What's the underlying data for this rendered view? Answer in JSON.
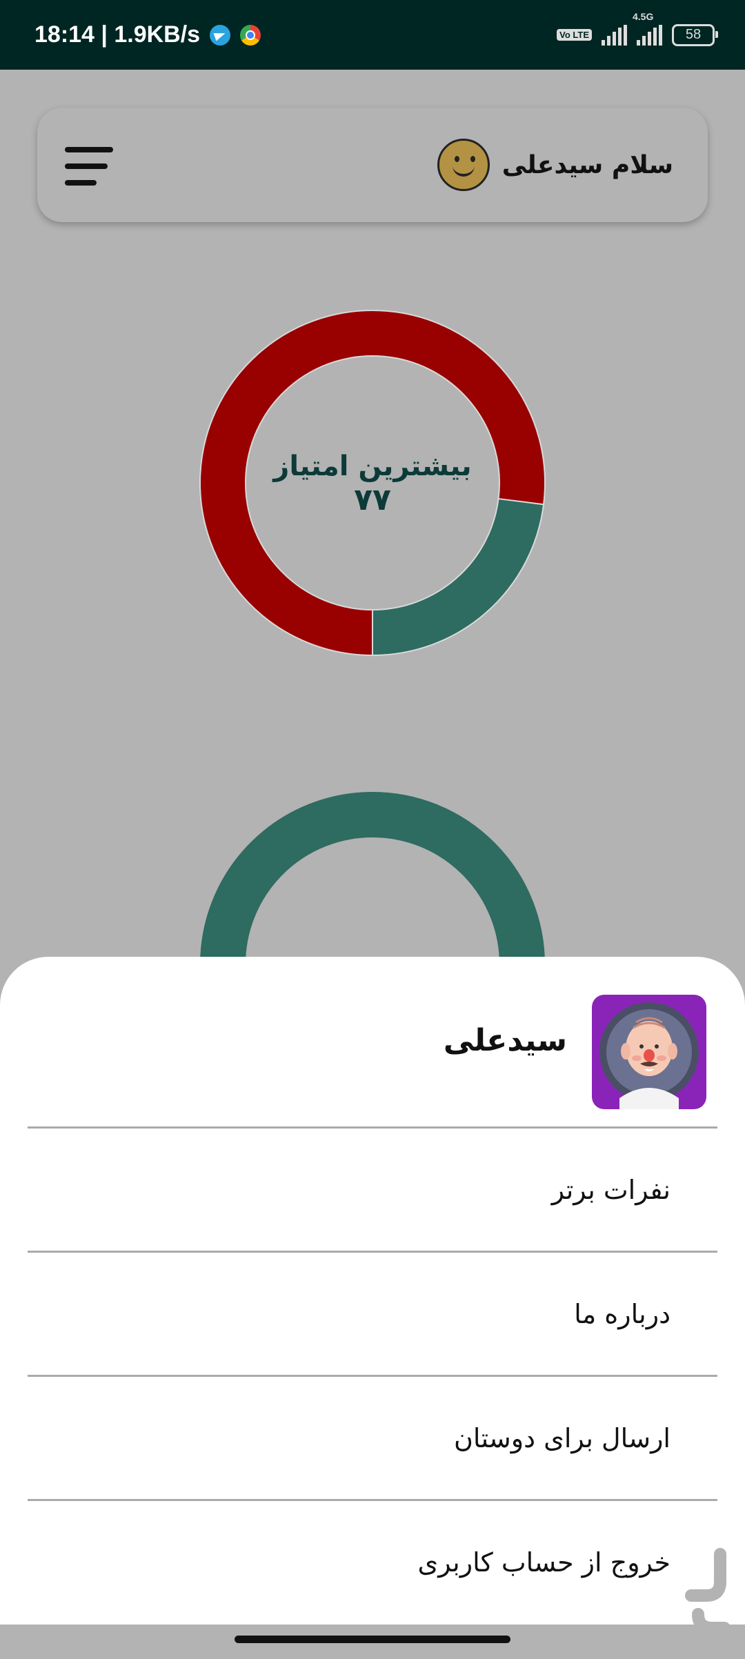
{
  "status_bar": {
    "time_speed": "18:14 | 1.9KB/s",
    "volte": "Vo LTE",
    "network": "4.5G",
    "battery": "58"
  },
  "header": {
    "greeting": "سلام سیدعلی"
  },
  "charts": {
    "top": {
      "title": "بیشترین امتیاز",
      "value": "۷۷"
    }
  },
  "chart_data": [
    {
      "type": "pie",
      "title": "بیشترین امتیاز",
      "center_value": "۷۷",
      "donut": true,
      "slices": [
        {
          "value": 77,
          "color": "#990000"
        },
        {
          "value": 23,
          "color": "#2e6b61"
        }
      ]
    },
    {
      "type": "pie",
      "donut": true,
      "slices": [
        {
          "value": 100,
          "color": "#2e6b61"
        }
      ]
    }
  ],
  "drawer": {
    "user_name": "سیدعلی",
    "items": [
      {
        "label": "نفرات برتر"
      },
      {
        "label": "درباره ما"
      },
      {
        "label": "ارسال برای دوستان"
      },
      {
        "label": "خروج از حساب کاربری"
      }
    ]
  },
  "colors": {
    "status_bar": "#002623",
    "background": "#b3b3b3",
    "accent_red": "#990000",
    "accent_green": "#2e6b61",
    "avatar_bg": "#8a24b8"
  }
}
